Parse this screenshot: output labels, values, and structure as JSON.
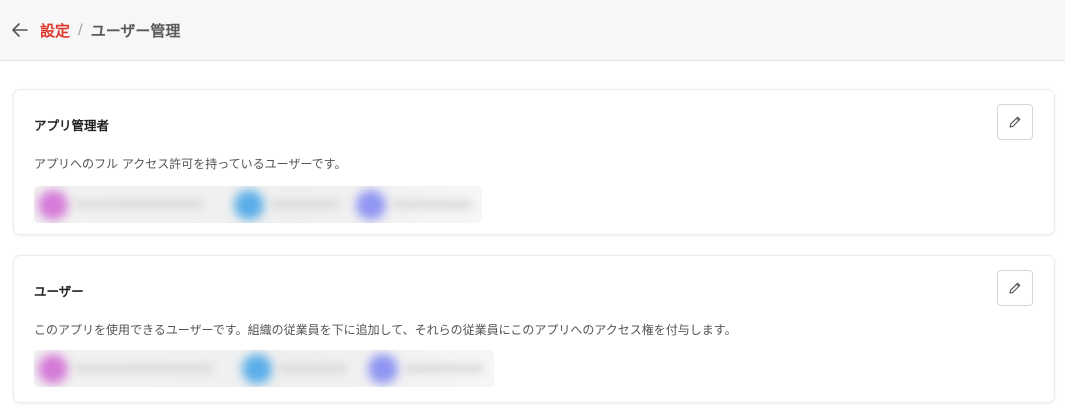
{
  "breadcrumb": {
    "parent": "設定",
    "separator": "/",
    "current": "ユーザー管理"
  },
  "cards": [
    {
      "title": "アプリ管理者",
      "description": "アプリへのフル アクセス許可を持っているユーザーです。",
      "members": [
        {
          "avatar_color": "#d57ad8"
        },
        {
          "avatar_color": "#5aaee8"
        },
        {
          "avatar_color": "#8f95f2"
        }
      ]
    },
    {
      "title": "ユーザー",
      "description": "このアプリを使用できるユーザーです。組織の従業員を下に追加して、それらの従業員にこのアプリへのアクセス権を付与します。",
      "members": [
        {
          "avatar_color": "#d57ad8"
        },
        {
          "avatar_color": "#5aaee8"
        },
        {
          "avatar_color": "#8f95f2"
        }
      ]
    }
  ],
  "icons": {
    "back": "arrow-left-icon",
    "edit": "pencil-icon"
  },
  "colors": {
    "accent": "#e0382c",
    "header_bg": "#f7f7f7"
  }
}
